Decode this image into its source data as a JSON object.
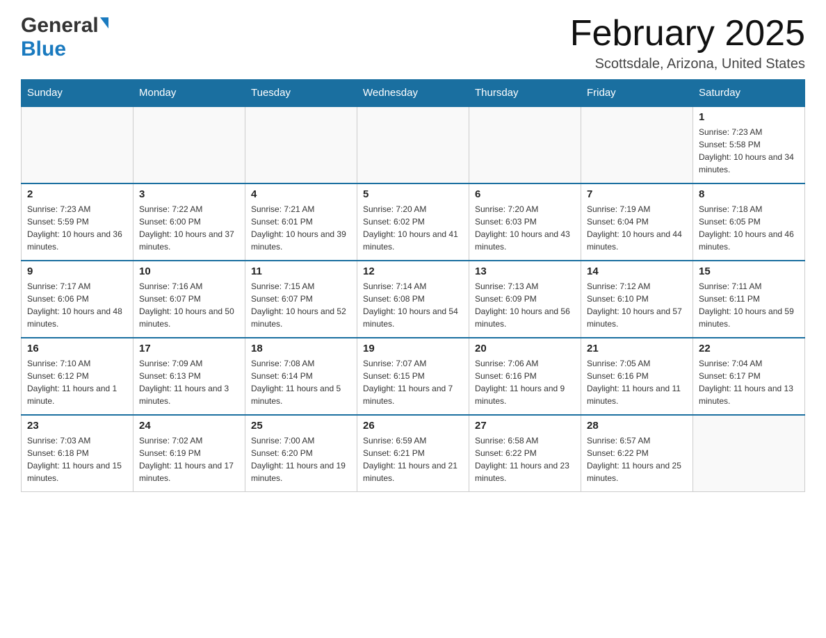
{
  "header": {
    "logo_general": "General",
    "logo_blue": "Blue",
    "month_title": "February 2025",
    "location": "Scottsdale, Arizona, United States"
  },
  "days_of_week": [
    "Sunday",
    "Monday",
    "Tuesday",
    "Wednesday",
    "Thursday",
    "Friday",
    "Saturday"
  ],
  "weeks": [
    [
      {
        "day": "",
        "sunrise": "",
        "sunset": "",
        "daylight": ""
      },
      {
        "day": "",
        "sunrise": "",
        "sunset": "",
        "daylight": ""
      },
      {
        "day": "",
        "sunrise": "",
        "sunset": "",
        "daylight": ""
      },
      {
        "day": "",
        "sunrise": "",
        "sunset": "",
        "daylight": ""
      },
      {
        "day": "",
        "sunrise": "",
        "sunset": "",
        "daylight": ""
      },
      {
        "day": "",
        "sunrise": "",
        "sunset": "",
        "daylight": ""
      },
      {
        "day": "1",
        "sunrise": "Sunrise: 7:23 AM",
        "sunset": "Sunset: 5:58 PM",
        "daylight": "Daylight: 10 hours and 34 minutes."
      }
    ],
    [
      {
        "day": "2",
        "sunrise": "Sunrise: 7:23 AM",
        "sunset": "Sunset: 5:59 PM",
        "daylight": "Daylight: 10 hours and 36 minutes."
      },
      {
        "day": "3",
        "sunrise": "Sunrise: 7:22 AM",
        "sunset": "Sunset: 6:00 PM",
        "daylight": "Daylight: 10 hours and 37 minutes."
      },
      {
        "day": "4",
        "sunrise": "Sunrise: 7:21 AM",
        "sunset": "Sunset: 6:01 PM",
        "daylight": "Daylight: 10 hours and 39 minutes."
      },
      {
        "day": "5",
        "sunrise": "Sunrise: 7:20 AM",
        "sunset": "Sunset: 6:02 PM",
        "daylight": "Daylight: 10 hours and 41 minutes."
      },
      {
        "day": "6",
        "sunrise": "Sunrise: 7:20 AM",
        "sunset": "Sunset: 6:03 PM",
        "daylight": "Daylight: 10 hours and 43 minutes."
      },
      {
        "day": "7",
        "sunrise": "Sunrise: 7:19 AM",
        "sunset": "Sunset: 6:04 PM",
        "daylight": "Daylight: 10 hours and 44 minutes."
      },
      {
        "day": "8",
        "sunrise": "Sunrise: 7:18 AM",
        "sunset": "Sunset: 6:05 PM",
        "daylight": "Daylight: 10 hours and 46 minutes."
      }
    ],
    [
      {
        "day": "9",
        "sunrise": "Sunrise: 7:17 AM",
        "sunset": "Sunset: 6:06 PM",
        "daylight": "Daylight: 10 hours and 48 minutes."
      },
      {
        "day": "10",
        "sunrise": "Sunrise: 7:16 AM",
        "sunset": "Sunset: 6:07 PM",
        "daylight": "Daylight: 10 hours and 50 minutes."
      },
      {
        "day": "11",
        "sunrise": "Sunrise: 7:15 AM",
        "sunset": "Sunset: 6:07 PM",
        "daylight": "Daylight: 10 hours and 52 minutes."
      },
      {
        "day": "12",
        "sunrise": "Sunrise: 7:14 AM",
        "sunset": "Sunset: 6:08 PM",
        "daylight": "Daylight: 10 hours and 54 minutes."
      },
      {
        "day": "13",
        "sunrise": "Sunrise: 7:13 AM",
        "sunset": "Sunset: 6:09 PM",
        "daylight": "Daylight: 10 hours and 56 minutes."
      },
      {
        "day": "14",
        "sunrise": "Sunrise: 7:12 AM",
        "sunset": "Sunset: 6:10 PM",
        "daylight": "Daylight: 10 hours and 57 minutes."
      },
      {
        "day": "15",
        "sunrise": "Sunrise: 7:11 AM",
        "sunset": "Sunset: 6:11 PM",
        "daylight": "Daylight: 10 hours and 59 minutes."
      }
    ],
    [
      {
        "day": "16",
        "sunrise": "Sunrise: 7:10 AM",
        "sunset": "Sunset: 6:12 PM",
        "daylight": "Daylight: 11 hours and 1 minute."
      },
      {
        "day": "17",
        "sunrise": "Sunrise: 7:09 AM",
        "sunset": "Sunset: 6:13 PM",
        "daylight": "Daylight: 11 hours and 3 minutes."
      },
      {
        "day": "18",
        "sunrise": "Sunrise: 7:08 AM",
        "sunset": "Sunset: 6:14 PM",
        "daylight": "Daylight: 11 hours and 5 minutes."
      },
      {
        "day": "19",
        "sunrise": "Sunrise: 7:07 AM",
        "sunset": "Sunset: 6:15 PM",
        "daylight": "Daylight: 11 hours and 7 minutes."
      },
      {
        "day": "20",
        "sunrise": "Sunrise: 7:06 AM",
        "sunset": "Sunset: 6:16 PM",
        "daylight": "Daylight: 11 hours and 9 minutes."
      },
      {
        "day": "21",
        "sunrise": "Sunrise: 7:05 AM",
        "sunset": "Sunset: 6:16 PM",
        "daylight": "Daylight: 11 hours and 11 minutes."
      },
      {
        "day": "22",
        "sunrise": "Sunrise: 7:04 AM",
        "sunset": "Sunset: 6:17 PM",
        "daylight": "Daylight: 11 hours and 13 minutes."
      }
    ],
    [
      {
        "day": "23",
        "sunrise": "Sunrise: 7:03 AM",
        "sunset": "Sunset: 6:18 PM",
        "daylight": "Daylight: 11 hours and 15 minutes."
      },
      {
        "day": "24",
        "sunrise": "Sunrise: 7:02 AM",
        "sunset": "Sunset: 6:19 PM",
        "daylight": "Daylight: 11 hours and 17 minutes."
      },
      {
        "day": "25",
        "sunrise": "Sunrise: 7:00 AM",
        "sunset": "Sunset: 6:20 PM",
        "daylight": "Daylight: 11 hours and 19 minutes."
      },
      {
        "day": "26",
        "sunrise": "Sunrise: 6:59 AM",
        "sunset": "Sunset: 6:21 PM",
        "daylight": "Daylight: 11 hours and 21 minutes."
      },
      {
        "day": "27",
        "sunrise": "Sunrise: 6:58 AM",
        "sunset": "Sunset: 6:22 PM",
        "daylight": "Daylight: 11 hours and 23 minutes."
      },
      {
        "day": "28",
        "sunrise": "Sunrise: 6:57 AM",
        "sunset": "Sunset: 6:22 PM",
        "daylight": "Daylight: 11 hours and 25 minutes."
      },
      {
        "day": "",
        "sunrise": "",
        "sunset": "",
        "daylight": ""
      }
    ]
  ]
}
